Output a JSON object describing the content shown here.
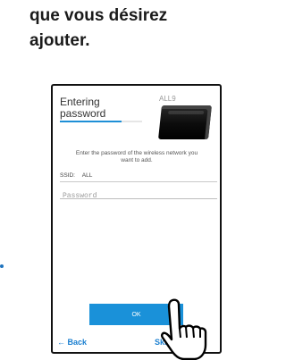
{
  "heading": {
    "line1": "que vous désirez",
    "line2": "ajouter."
  },
  "screen": {
    "title_line1": "Entering",
    "title_line2": "password",
    "title_progress": 0.75,
    "device_label": "ALL9",
    "instruction_line1": "Enter the password of the wireless network you",
    "instruction_line2": "want to add.",
    "ssid_label": "SSID:",
    "ssid_value": "ALL",
    "password_placeholder": "Password",
    "ok_label": "OK",
    "back_label": "← Back",
    "skip_label": "Skip"
  },
  "colors": {
    "accent": "#1a91d9",
    "link": "#1a7fd0"
  }
}
